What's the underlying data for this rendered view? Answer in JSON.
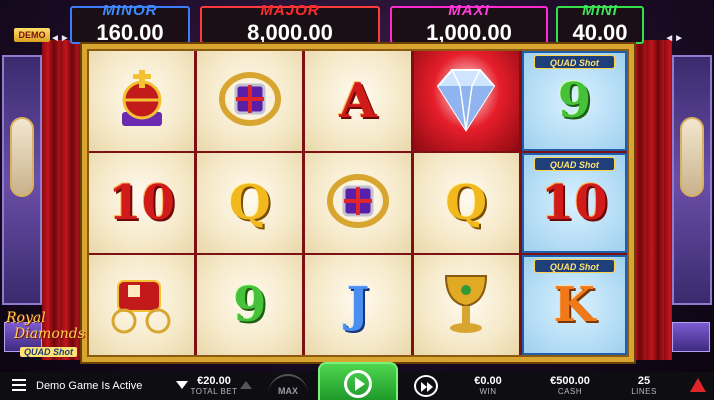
{
  "jackpots": {
    "minor": {
      "title": "MINOR",
      "value": "160.00"
    },
    "major": {
      "title": "MAJOR",
      "value": "8,000.00"
    },
    "maxi": {
      "title": "MAXI",
      "value": "1,000.00"
    },
    "mini": {
      "title": "MINI",
      "value": "40.00"
    }
  },
  "demo_badge": "DEMO",
  "logo": {
    "line1": "Royal",
    "line2": "Diamonds",
    "line3": "QUAD Shot"
  },
  "reels": [
    [
      {
        "type": "icon",
        "icon": "orb-crown-icon"
      },
      {
        "type": "text",
        "text": "10",
        "color": "red"
      },
      {
        "type": "icon",
        "icon": "carriage-icon"
      }
    ],
    [
      {
        "type": "icon",
        "icon": "ring-icon"
      },
      {
        "type": "text",
        "text": "Q",
        "color": "gold"
      },
      {
        "type": "text",
        "text": "9",
        "color": "green"
      }
    ],
    [
      {
        "type": "text",
        "text": "A",
        "color": "red"
      },
      {
        "type": "icon",
        "icon": "ring-icon"
      },
      {
        "type": "text",
        "text": "J",
        "color": "blue"
      }
    ],
    [
      {
        "type": "icon",
        "icon": "diamond-icon"
      },
      {
        "type": "text",
        "text": "Q",
        "color": "gold"
      },
      {
        "type": "icon",
        "icon": "chalice-icon"
      }
    ],
    [
      {
        "type": "quad",
        "tag": "QUAD Shot",
        "text": "9",
        "color": "green"
      },
      {
        "type": "quad",
        "tag": "QUAD Shot",
        "text": "10",
        "color": "red"
      },
      {
        "type": "quad",
        "tag": "QUAD Shot",
        "text": "K",
        "color": "orange"
      }
    ]
  ],
  "bottom_bar": {
    "status": "Demo Game Is Active",
    "total_bet": {
      "value": "€20.00",
      "label": "TOTAL BET"
    },
    "max_label": "MAX",
    "win": {
      "value": "€0.00",
      "label": "WIN"
    },
    "cash": {
      "value": "€500.00",
      "label": "CASH"
    },
    "lines": {
      "value": "25",
      "label": "LINES"
    }
  },
  "colors": {
    "minor": "#3d8bff",
    "major": "#ff2a2a",
    "maxi": "#ff3bd9",
    "mini": "#3de35a",
    "spin": "#2fb83a",
    "frame": "#d9a531"
  }
}
